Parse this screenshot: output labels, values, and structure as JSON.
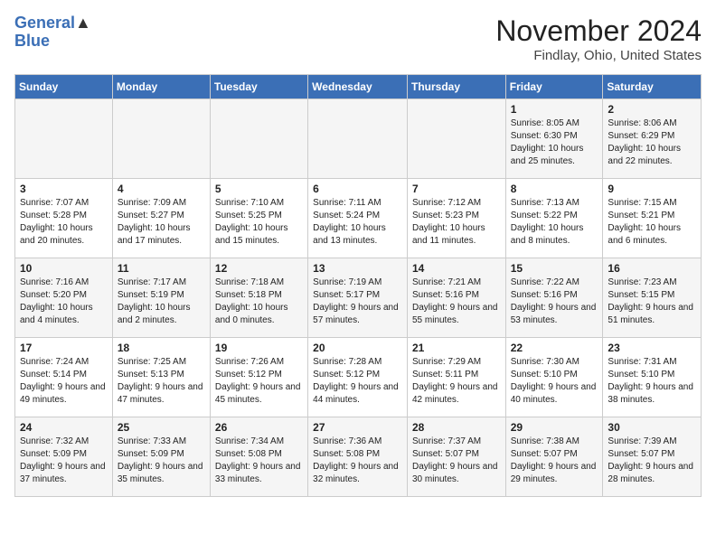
{
  "header": {
    "logo_line1": "General",
    "logo_line2": "Blue",
    "month_title": "November 2024",
    "location": "Findlay, Ohio, United States"
  },
  "days_of_week": [
    "Sunday",
    "Monday",
    "Tuesday",
    "Wednesday",
    "Thursday",
    "Friday",
    "Saturday"
  ],
  "weeks": [
    [
      {
        "day": "",
        "info": ""
      },
      {
        "day": "",
        "info": ""
      },
      {
        "day": "",
        "info": ""
      },
      {
        "day": "",
        "info": ""
      },
      {
        "day": "",
        "info": ""
      },
      {
        "day": "1",
        "info": "Sunrise: 8:05 AM\nSunset: 6:30 PM\nDaylight: 10 hours and 25 minutes."
      },
      {
        "day": "2",
        "info": "Sunrise: 8:06 AM\nSunset: 6:29 PM\nDaylight: 10 hours and 22 minutes."
      }
    ],
    [
      {
        "day": "3",
        "info": "Sunrise: 7:07 AM\nSunset: 5:28 PM\nDaylight: 10 hours and 20 minutes."
      },
      {
        "day": "4",
        "info": "Sunrise: 7:09 AM\nSunset: 5:27 PM\nDaylight: 10 hours and 17 minutes."
      },
      {
        "day": "5",
        "info": "Sunrise: 7:10 AM\nSunset: 5:25 PM\nDaylight: 10 hours and 15 minutes."
      },
      {
        "day": "6",
        "info": "Sunrise: 7:11 AM\nSunset: 5:24 PM\nDaylight: 10 hours and 13 minutes."
      },
      {
        "day": "7",
        "info": "Sunrise: 7:12 AM\nSunset: 5:23 PM\nDaylight: 10 hours and 11 minutes."
      },
      {
        "day": "8",
        "info": "Sunrise: 7:13 AM\nSunset: 5:22 PM\nDaylight: 10 hours and 8 minutes."
      },
      {
        "day": "9",
        "info": "Sunrise: 7:15 AM\nSunset: 5:21 PM\nDaylight: 10 hours and 6 minutes."
      }
    ],
    [
      {
        "day": "10",
        "info": "Sunrise: 7:16 AM\nSunset: 5:20 PM\nDaylight: 10 hours and 4 minutes."
      },
      {
        "day": "11",
        "info": "Sunrise: 7:17 AM\nSunset: 5:19 PM\nDaylight: 10 hours and 2 minutes."
      },
      {
        "day": "12",
        "info": "Sunrise: 7:18 AM\nSunset: 5:18 PM\nDaylight: 10 hours and 0 minutes."
      },
      {
        "day": "13",
        "info": "Sunrise: 7:19 AM\nSunset: 5:17 PM\nDaylight: 9 hours and 57 minutes."
      },
      {
        "day": "14",
        "info": "Sunrise: 7:21 AM\nSunset: 5:16 PM\nDaylight: 9 hours and 55 minutes."
      },
      {
        "day": "15",
        "info": "Sunrise: 7:22 AM\nSunset: 5:16 PM\nDaylight: 9 hours and 53 minutes."
      },
      {
        "day": "16",
        "info": "Sunrise: 7:23 AM\nSunset: 5:15 PM\nDaylight: 9 hours and 51 minutes."
      }
    ],
    [
      {
        "day": "17",
        "info": "Sunrise: 7:24 AM\nSunset: 5:14 PM\nDaylight: 9 hours and 49 minutes."
      },
      {
        "day": "18",
        "info": "Sunrise: 7:25 AM\nSunset: 5:13 PM\nDaylight: 9 hours and 47 minutes."
      },
      {
        "day": "19",
        "info": "Sunrise: 7:26 AM\nSunset: 5:12 PM\nDaylight: 9 hours and 45 minutes."
      },
      {
        "day": "20",
        "info": "Sunrise: 7:28 AM\nSunset: 5:12 PM\nDaylight: 9 hours and 44 minutes."
      },
      {
        "day": "21",
        "info": "Sunrise: 7:29 AM\nSunset: 5:11 PM\nDaylight: 9 hours and 42 minutes."
      },
      {
        "day": "22",
        "info": "Sunrise: 7:30 AM\nSunset: 5:10 PM\nDaylight: 9 hours and 40 minutes."
      },
      {
        "day": "23",
        "info": "Sunrise: 7:31 AM\nSunset: 5:10 PM\nDaylight: 9 hours and 38 minutes."
      }
    ],
    [
      {
        "day": "24",
        "info": "Sunrise: 7:32 AM\nSunset: 5:09 PM\nDaylight: 9 hours and 37 minutes."
      },
      {
        "day": "25",
        "info": "Sunrise: 7:33 AM\nSunset: 5:09 PM\nDaylight: 9 hours and 35 minutes."
      },
      {
        "day": "26",
        "info": "Sunrise: 7:34 AM\nSunset: 5:08 PM\nDaylight: 9 hours and 33 minutes."
      },
      {
        "day": "27",
        "info": "Sunrise: 7:36 AM\nSunset: 5:08 PM\nDaylight: 9 hours and 32 minutes."
      },
      {
        "day": "28",
        "info": "Sunrise: 7:37 AM\nSunset: 5:07 PM\nDaylight: 9 hours and 30 minutes."
      },
      {
        "day": "29",
        "info": "Sunrise: 7:38 AM\nSunset: 5:07 PM\nDaylight: 9 hours and 29 minutes."
      },
      {
        "day": "30",
        "info": "Sunrise: 7:39 AM\nSunset: 5:07 PM\nDaylight: 9 hours and 28 minutes."
      }
    ]
  ]
}
